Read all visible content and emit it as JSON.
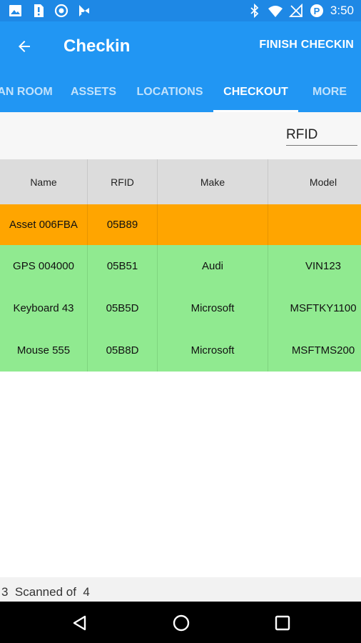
{
  "status_bar": {
    "time": "3:50",
    "left_icons": [
      "image-icon",
      "sim-card-alert-icon",
      "record-icon",
      "play-store-icon"
    ],
    "right_icons": [
      "bluetooth-icon",
      "wifi-icon",
      "no-signal-icon",
      "data-saver-icon"
    ]
  },
  "app_bar": {
    "title": "Checkin",
    "action": "FINISH CHECKIN",
    "back_icon": "arrow-back-icon",
    "color": "#2196f3"
  },
  "tabs": [
    {
      "label": "AN ROOM",
      "active": false
    },
    {
      "label": "ASSETS",
      "active": false
    },
    {
      "label": "LOCATIONS",
      "active": false
    },
    {
      "label": "CHECKOUT",
      "active": true
    },
    {
      "label": "MORE",
      "active": false
    }
  ],
  "filter": {
    "value": "RFID"
  },
  "table": {
    "headers": [
      "Name",
      "RFID",
      "Make",
      "Model"
    ],
    "rows": [
      {
        "name": "Asset 006FBA",
        "rfid": "05B89",
        "make": "",
        "model": "",
        "status_color": "#ffa500"
      },
      {
        "name": "GPS 004000",
        "rfid": "05B51",
        "make": "Audi",
        "model": "VIN123",
        "status_color": "#90ea90"
      },
      {
        "name": "Keyboard 43",
        "rfid": "05B5D",
        "make": "Microsoft",
        "model": "MSFTKY1100",
        "status_color": "#90ea90"
      },
      {
        "name": "Mouse 555",
        "rfid": "05B8D",
        "make": "Microsoft",
        "model": "MSFTMS200",
        "status_color": "#90ea90"
      }
    ]
  },
  "footer": {
    "scanned": "3",
    "scanned_label": "Scanned of",
    "total": "4"
  },
  "nav_bar": {
    "icons": [
      "back-triangle-icon",
      "home-circle-icon",
      "recents-square-icon"
    ]
  }
}
